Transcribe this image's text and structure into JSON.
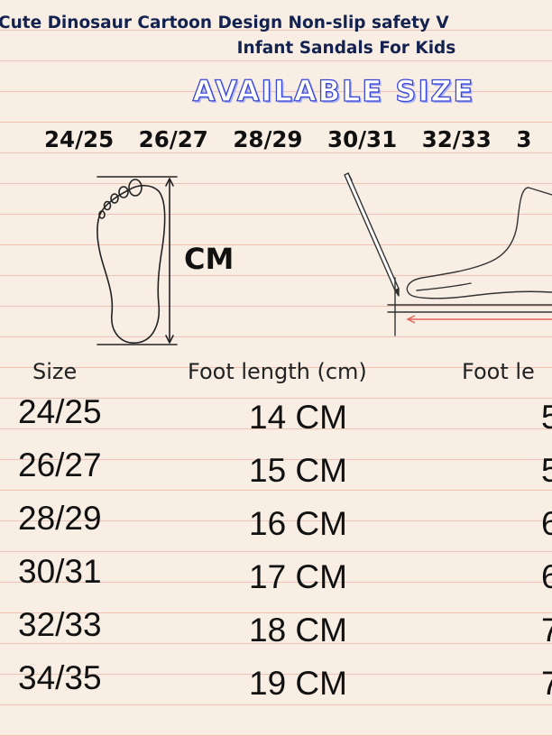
{
  "title": {
    "line1": "Cute Dinosaur Cartoon Design Non-slip safety V",
    "line2": "Infant Sandals For Kids"
  },
  "available_size_heading": "AVAILABLE SIZE",
  "size_strip": [
    "24/25",
    "26/27",
    "28/29",
    "30/31",
    "32/33",
    "3"
  ],
  "cm_label": "CM",
  "table": {
    "headers": {
      "size": "Size",
      "foot_length": "Foot length (cm)",
      "foot_length_clipped": "Foot le"
    },
    "rows": [
      {
        "size": "24/25",
        "foot_length": "14 CM",
        "clipped": "5"
      },
      {
        "size": "26/27",
        "foot_length": "15 CM",
        "clipped": "5"
      },
      {
        "size": "28/29",
        "foot_length": "16 CM",
        "clipped": "6"
      },
      {
        "size": "30/31",
        "foot_length": "17 CM",
        "clipped": "6"
      },
      {
        "size": "32/33",
        "foot_length": "18 CM",
        "clipped": "7"
      },
      {
        "size": "34/35",
        "foot_length": "19 CM",
        "clipped": "7"
      }
    ]
  },
  "colors": {
    "background": "#f8eee4",
    "rule_lines": "#eec3b6",
    "title": "#14224f",
    "heading_outline": "#3946d6",
    "arrow_red": "#e2655a"
  }
}
